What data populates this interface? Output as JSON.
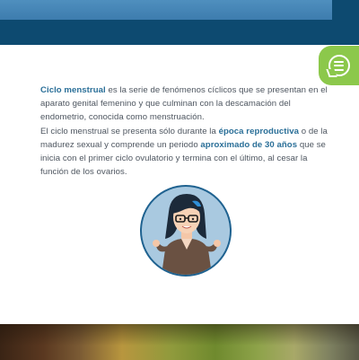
{
  "colors": {
    "header_dark": "#0d4a70",
    "header_light": "#4f8fbe",
    "chat_green": "#8cc84b",
    "highlight": "#2a6f98",
    "body_text": "#4e5660"
  },
  "chat": {
    "icon": "chat-bubble-icon"
  },
  "article": {
    "p1": {
      "hl": "Ciclo menstrual",
      "text": " es la serie de fenómenos cíclicos que se presentan en el aparato genital femenino y que culminan con la descamación del endometrio, conocida como menstruación."
    },
    "p2": {
      "a": "El ciclo menstrual se presenta sólo durante la ",
      "hl1": "época reproductiva",
      "b": " o de la madurez sexual y comprende un periodo ",
      "hl2": "aproximado de 30 años",
      "c": " que se inicia con el primer ciclo ovulatorio y termina con el último, al cesar la función de los ovarios."
    }
  },
  "avatar": {
    "icon": "woman-avatar-illustration"
  }
}
